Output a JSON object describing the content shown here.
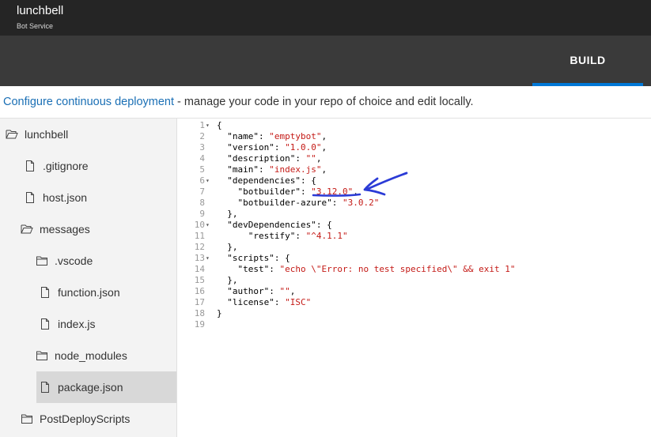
{
  "header": {
    "app_name": "lunchbell",
    "app_subtitle": "Bot Service"
  },
  "tabs": {
    "build_label": "BUILD"
  },
  "description": {
    "link_text": "Configure continuous deployment",
    "rest_text": " - manage your code in your repo of choice and edit locally."
  },
  "tree": {
    "items": [
      {
        "label": "lunchbell",
        "icon": "folder-open-icon"
      },
      {
        "label": ".gitignore",
        "icon": "file-icon"
      },
      {
        "label": "host.json",
        "icon": "file-icon"
      },
      {
        "label": "messages",
        "icon": "folder-open-icon"
      },
      {
        "label": ".vscode",
        "icon": "folder-icon"
      },
      {
        "label": "function.json",
        "icon": "file-icon"
      },
      {
        "label": "index.js",
        "icon": "file-icon"
      },
      {
        "label": "node_modules",
        "icon": "folder-icon"
      },
      {
        "label": "package.json",
        "icon": "file-icon",
        "selected": true
      },
      {
        "label": "PostDeployScripts",
        "icon": "folder-icon"
      }
    ]
  },
  "code": {
    "line_numbers": [
      "1",
      "2",
      "3",
      "4",
      "5",
      "6",
      "7",
      "8",
      "9",
      "10",
      "11",
      "12",
      "13",
      "14",
      "15",
      "16",
      "17",
      "18",
      "19"
    ],
    "lines": [
      {
        "pre": "{",
        "str": "",
        "post": ""
      },
      {
        "pre": "  \"name\": ",
        "str": "\"emptybot\"",
        "post": ","
      },
      {
        "pre": "  \"version\": ",
        "str": "\"1.0.0\"",
        "post": ","
      },
      {
        "pre": "  \"description\": ",
        "str": "\"\"",
        "post": ","
      },
      {
        "pre": "  \"main\": ",
        "str": "\"index.js\"",
        "post": ","
      },
      {
        "pre": "  \"dependencies\": {",
        "str": "",
        "post": ""
      },
      {
        "pre": "    \"botbuilder\": ",
        "str": "\"3.12.0\"",
        "post": ","
      },
      {
        "pre": "    \"botbuilder-azure\": ",
        "str": "\"3.0.2\"",
        "post": ""
      },
      {
        "pre": "  },",
        "str": "",
        "post": ""
      },
      {
        "pre": "  \"devDependencies\": {",
        "str": "",
        "post": ""
      },
      {
        "pre": "      \"restify\": ",
        "str": "\"^4.1.1\"",
        "post": ""
      },
      {
        "pre": "  },",
        "str": "",
        "post": ""
      },
      {
        "pre": "  \"scripts\": {",
        "str": "",
        "post": ""
      },
      {
        "pre": "    \"test\": ",
        "str": "\"echo \\\"Error: no test specified\\\" && exit 1\"",
        "post": ""
      },
      {
        "pre": "  },",
        "str": "",
        "post": ""
      },
      {
        "pre": "  \"author\": ",
        "str": "\"\"",
        "post": ","
      },
      {
        "pre": "  \"license\": ",
        "str": "\"ISC\"",
        "post": ""
      },
      {
        "pre": "}",
        "str": "",
        "post": ""
      },
      {
        "pre": "",
        "str": "",
        "post": ""
      }
    ],
    "fold_markers": {
      "1": "▾",
      "6": "▾",
      "10": "▾",
      "13": "▾"
    }
  },
  "colors": {
    "accent": "#0078d7",
    "string": "#c41a16",
    "annotation": "#2b3bd6"
  }
}
